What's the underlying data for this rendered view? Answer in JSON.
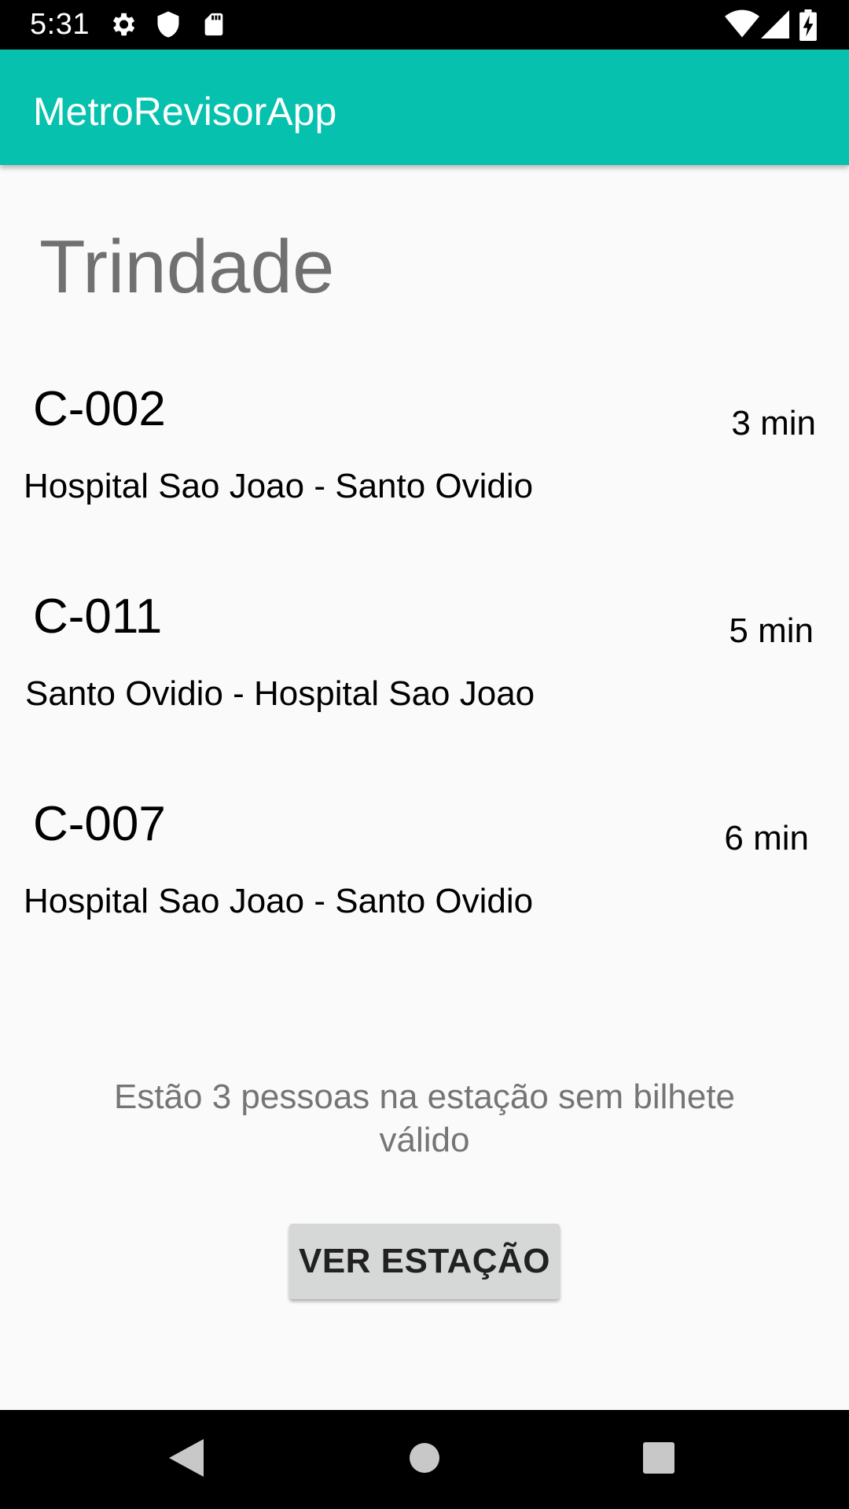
{
  "status_bar": {
    "time": "5:31",
    "left_icons": [
      "gear-icon",
      "shield-icon",
      "sd-card-icon"
    ],
    "right_icons": [
      "wifi-icon",
      "signal-icon",
      "battery-charging-icon"
    ]
  },
  "app_bar": {
    "title": "MetroRevisorApp",
    "color": "#06c1ad"
  },
  "station": {
    "name": "Trindade"
  },
  "trains": [
    {
      "code": "C-002",
      "time": "3 min",
      "route": "Hospital Sao Joao - Santo Ovidio"
    },
    {
      "code": "C-011",
      "time": "5 min",
      "route": "Santo Ovidio - Hospital Sao Joao"
    },
    {
      "code": "C-007",
      "time": "6 min",
      "route": "Hospital Sao Joao - Santo Ovidio"
    }
  ],
  "info": {
    "text": "Estão 3 pessoas na estação sem bilhete válido"
  },
  "button": {
    "label": "VER ESTAÇÃO"
  },
  "nav_bar": {
    "icons": [
      "back-icon",
      "home-icon",
      "recents-icon"
    ]
  }
}
